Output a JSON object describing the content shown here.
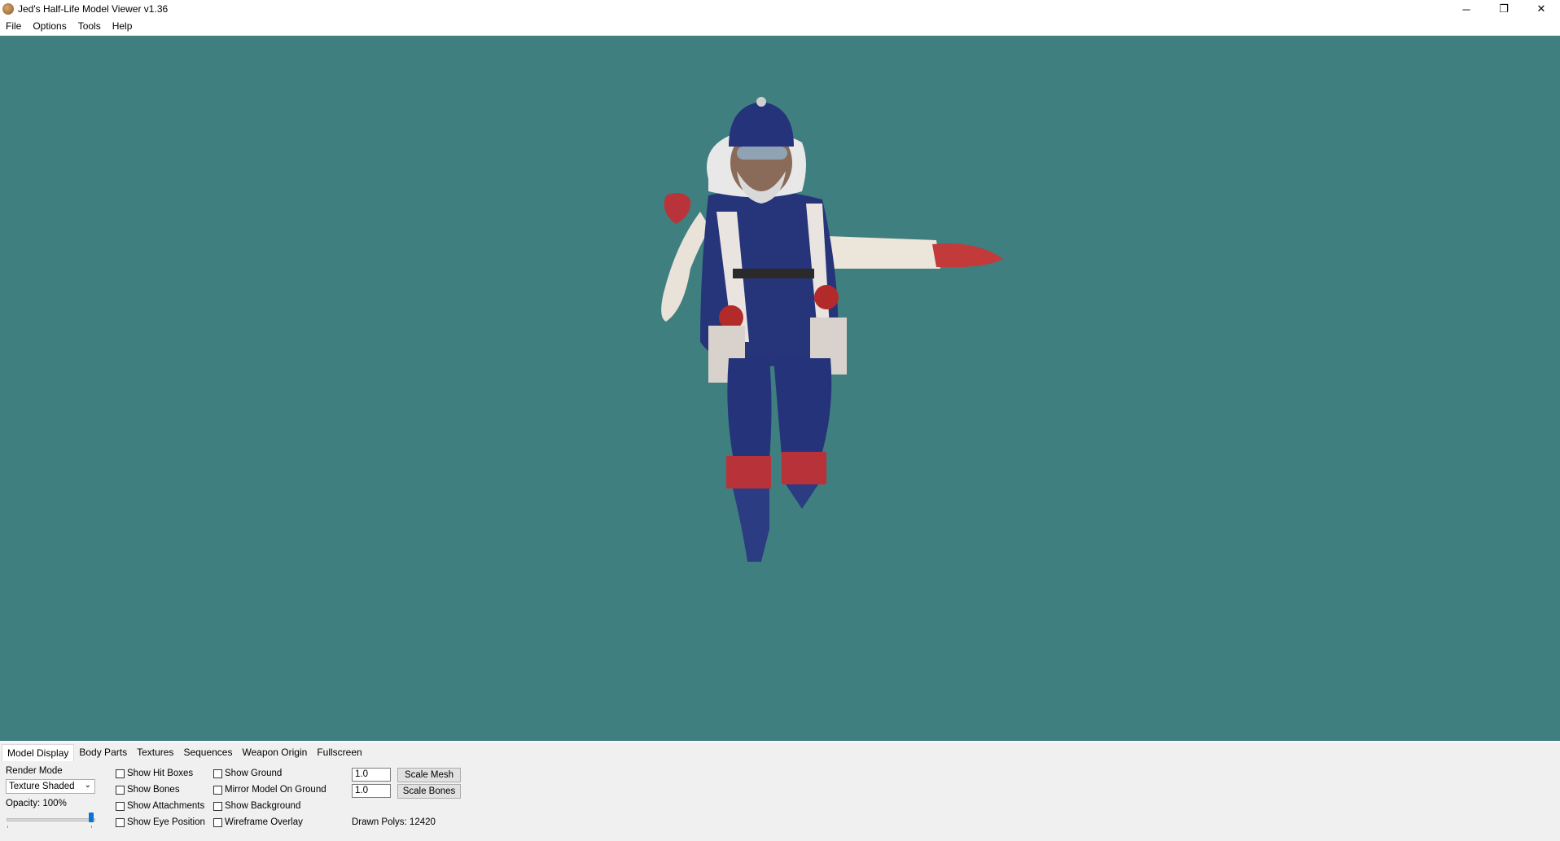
{
  "window": {
    "title": "Jed's Half-Life Model Viewer v1.36",
    "controls": {
      "minimize": "─",
      "restore": "❐",
      "close": "✕"
    }
  },
  "menu": [
    "File",
    "Options",
    "Tools",
    "Help"
  ],
  "viewport": {
    "background": "#407f7f"
  },
  "tabs": [
    "Model Display",
    "Body Parts",
    "Textures",
    "Sequences",
    "Weapon Origin",
    "Fullscreen"
  ],
  "model_display": {
    "render_mode_label": "Render Mode",
    "render_mode_value": "Texture Shaded",
    "opacity_label": "Opacity: 100%",
    "opacity_level": 1.0,
    "checkboxes_col1": [
      "Show Hit Boxes",
      "Show Bones",
      "Show Attachments",
      "Show Eye Position"
    ],
    "checkboxes_col2": [
      "Show Ground",
      "Mirror Model On Ground",
      "Show Background",
      "Wireframe Overlay"
    ],
    "scale_mesh_value": "1.0",
    "scale_bones_value": "1.0",
    "scale_mesh_button": "Scale Mesh",
    "scale_bones_button": "Scale Bones",
    "drawn_polys": "Drawn Polys: 12420"
  }
}
